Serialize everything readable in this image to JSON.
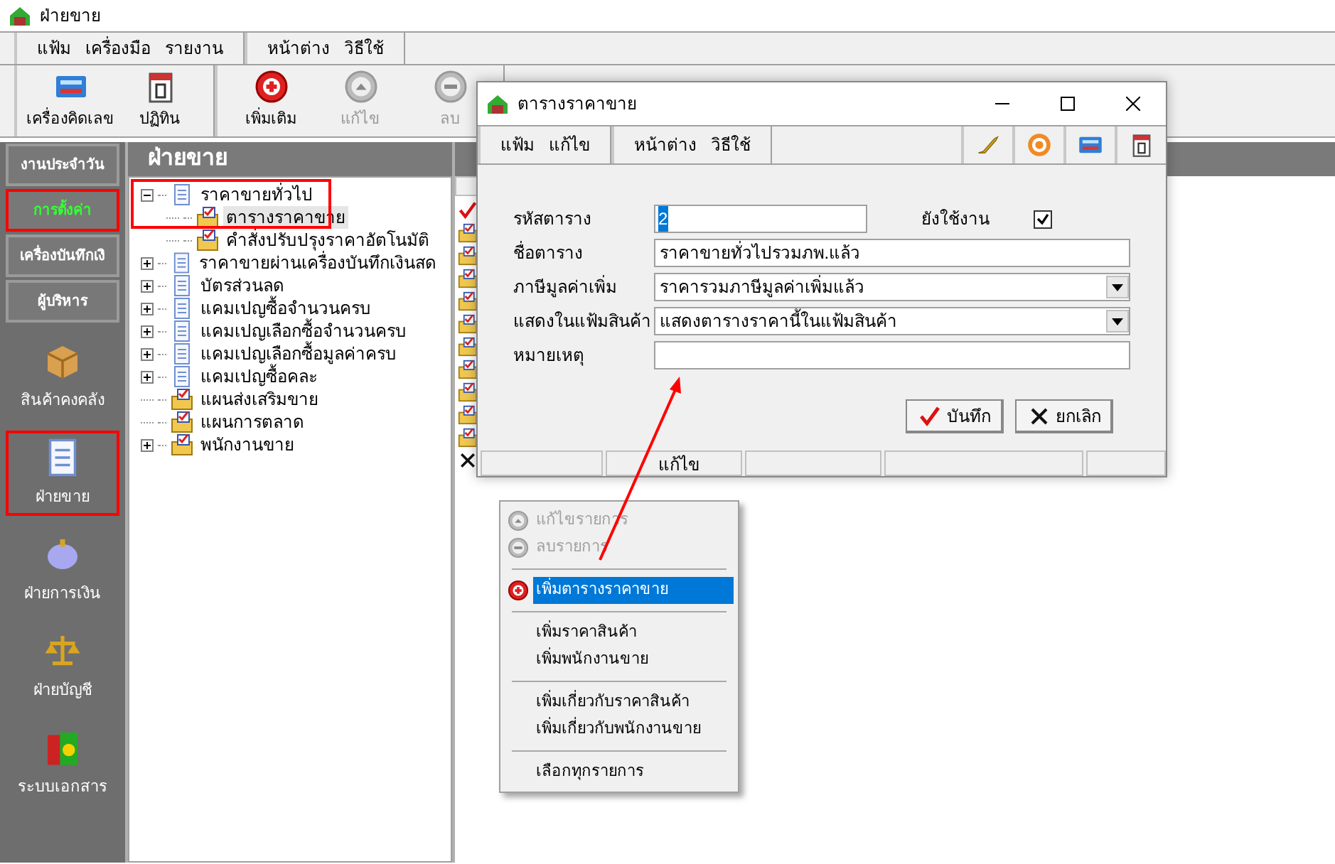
{
  "window": {
    "title": "ฝ่ายขาย"
  },
  "menu_groups": [
    [
      "แฟ้ม",
      "เครื่องมือ",
      "รายงาน"
    ],
    [
      "หน้าต่าง",
      "วิธีใช้"
    ]
  ],
  "toolbar_groups": [
    [
      {
        "label": "เครื่องคิดเลข",
        "disabled": false
      },
      {
        "label": "ปฏิทิน",
        "disabled": false
      }
    ],
    [
      {
        "label": "เพิ่มเติม",
        "disabled": false
      },
      {
        "label": "แก้ไข",
        "disabled": true
      },
      {
        "label": "ลบ",
        "disabled": true
      }
    ]
  ],
  "sidebar": {
    "tabs": [
      {
        "label": "งานประจำวัน",
        "selected": false,
        "highlighted": false
      },
      {
        "label": "การตั้งค่า",
        "selected": true,
        "highlighted": true
      },
      {
        "label": "เครื่องบันทึกเงิ",
        "selected": false,
        "highlighted": false
      },
      {
        "label": "ผู้บริหาร",
        "selected": false,
        "highlighted": false
      }
    ],
    "modules": [
      {
        "label": "สินค้าคงคลัง",
        "highlighted": false
      },
      {
        "label": "ฝ่ายขาย",
        "highlighted": true
      },
      {
        "label": "ฝ่ายการเงิน",
        "highlighted": false
      },
      {
        "label": "ฝ่ายบัญชี",
        "highlighted": false
      },
      {
        "label": "ระบบเอกสาร",
        "highlighted": false
      }
    ]
  },
  "panel": {
    "title": "ฝ่ายขาย",
    "highlight_frame": true,
    "tree": [
      {
        "label": "ราคาขายทั่วไป",
        "kind": "document",
        "expandable": true,
        "expanded": true,
        "selected": false,
        "children": [
          {
            "label": "ตารางราคาขาย",
            "kind": "folder",
            "expandable": false,
            "selected": true
          },
          {
            "label": "คำสั่งปรับปรุงราคาอัตโนมัติ",
            "kind": "folder",
            "expandable": false,
            "selected": false
          }
        ]
      },
      {
        "label": "ราคาขายผ่านเครื่องบันทึกเงินสด",
        "kind": "document",
        "expandable": true,
        "expanded": false,
        "selected": false
      },
      {
        "label": "บัตรส่วนลด",
        "kind": "document",
        "expandable": true,
        "expanded": false,
        "selected": false
      },
      {
        "label": "แคมเปญซื้อจำนวนครบ",
        "kind": "document",
        "expandable": true,
        "expanded": false,
        "selected": false
      },
      {
        "label": "แคมเปญเลือกซื้อจำนวนครบ",
        "kind": "document",
        "expandable": true,
        "expanded": false,
        "selected": false
      },
      {
        "label": "แคมเปญเลือกซื้อมูลค่าครบ",
        "kind": "document",
        "expandable": true,
        "expanded": false,
        "selected": false
      },
      {
        "label": "แคมเปญซื้อคละ",
        "kind": "document",
        "expandable": true,
        "expanded": false,
        "selected": false
      },
      {
        "label": "แผนส่งเสริมขาย",
        "kind": "folder",
        "expandable": false,
        "selected": false
      },
      {
        "label": "แผนการตลาด",
        "kind": "folder",
        "expandable": false,
        "selected": false
      },
      {
        "label": "พนักงานขาย",
        "kind": "folder",
        "expandable": true,
        "expanded": false,
        "selected": false
      }
    ]
  },
  "dialog": {
    "title": "ตารางราคาขาย",
    "menu_groups": [
      [
        "แฟ้ม",
        "แก้ไข"
      ],
      [
        "หน้าต่าง",
        "วิธีใช้"
      ]
    ],
    "code_field": {
      "label": "รหัสตาราง",
      "value": "2",
      "text_selected": true
    },
    "active_checkbox": {
      "label": "ยังใช้งาน",
      "checked": true
    },
    "fields": [
      {
        "kind": "text",
        "label": "ชื่อตาราง",
        "value": "ราคาขายทั่วไปรวมภพ.แล้ว"
      },
      {
        "kind": "select",
        "label": "ภาษีมูลค่าเพิ่ม",
        "value": "ราคารวมภาษีมูลค่าเพิ่มแล้ว"
      },
      {
        "kind": "select",
        "label": "แสดงในแฟ้มสินค้า",
        "value": "แสดงตารางราคานี้ในแฟ้มสินค้า"
      },
      {
        "kind": "text",
        "label": "หมายเหตุ"
      }
    ],
    "buttons": [
      "บันทึก",
      "ยกเลิก"
    ],
    "status_bar": {
      "mode": "แก้ไข"
    }
  },
  "context_menu": {
    "items": [
      {
        "kind": "item",
        "label": "แก้ไขรายการ",
        "disabled": true,
        "selected": false
      },
      {
        "kind": "item",
        "label": "ลบรายการ",
        "disabled": true,
        "selected": false
      },
      {
        "kind": "separator"
      },
      {
        "kind": "item",
        "label": "เพิ่มตารางราคาขาย",
        "disabled": false,
        "selected": true
      },
      {
        "kind": "separator"
      },
      {
        "kind": "item",
        "label": "เพิ่มราคาสินค้า",
        "disabled": false,
        "selected": false
      },
      {
        "kind": "item",
        "label": "เพิ่มพนักงานขาย",
        "disabled": false,
        "selected": false
      },
      {
        "kind": "separator"
      },
      {
        "kind": "item",
        "label": "เพิ่มเกี่ยวกับราคาสินค้า",
        "disabled": false,
        "selected": false
      },
      {
        "kind": "item",
        "label": "เพิ่มเกี่ยวกับพนักงานขาย",
        "disabled": false,
        "selected": false
      },
      {
        "kind": "separator"
      },
      {
        "kind": "item",
        "label": "เลือกทุกรายการ",
        "disabled": false,
        "selected": false
      }
    ]
  },
  "annotation_arrow": true
}
